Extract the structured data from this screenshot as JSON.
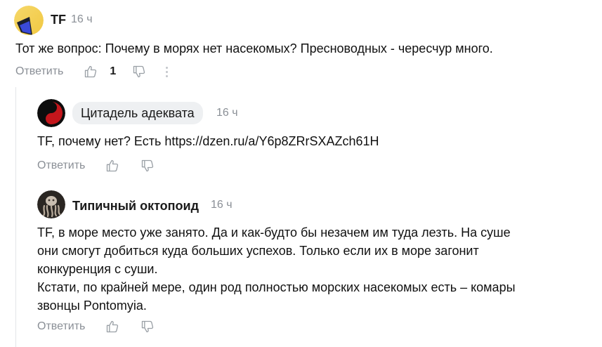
{
  "comments": [
    {
      "author": "TF",
      "time": "16 ч",
      "avatar_icon": "yellow-blue-gradient-avatar",
      "text": [
        "Тот же вопрос: Почему в морях нет насекомых? Пресноводных - чересчур много."
      ],
      "reply_label": "Ответить",
      "likes": "1"
    },
    {
      "author": "Цитадель адеквата",
      "time": "16 ч",
      "avatar_icon": "red-yin-yang-avatar",
      "text": [
        "TF, почему нет? Есть https://dzen.ru/a/Y6p8ZRrSXAZch61H"
      ],
      "reply_label": "Ответить"
    },
    {
      "author": "Типичный октопоид",
      "time": "16 ч",
      "avatar_icon": "octopus-sculpture-avatar",
      "text": [
        "TF, в море место уже занято. Да и как-будто бы незачем им туда лезть. На суше",
        "они смогут добиться куда больших успехов. Только если их в море загонит",
        "конкуренция с суши.",
        "Кстати, по крайней мере, один род полностью морских насекомых есть – комары",
        "звонцы Pontomyia."
      ],
      "reply_label": "Ответить"
    }
  ],
  "colors": {
    "muted": "#8a8f96",
    "chip_bg": "#eef0f2",
    "thread_line": "#e3e5e8"
  }
}
